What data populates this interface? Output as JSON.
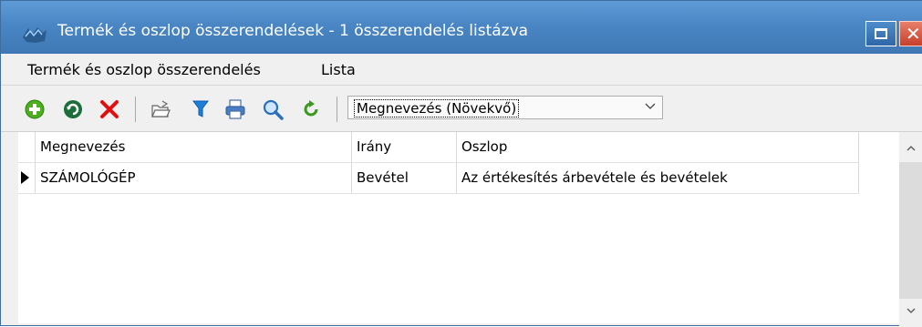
{
  "window": {
    "title": "Termék és oszlop összerendelések - 1 összerendelés listázva"
  },
  "menu": {
    "items": [
      {
        "label": "Termék és oszlop összerendelés"
      },
      {
        "label": "Lista"
      }
    ]
  },
  "toolbar": {
    "icons": [
      "add-icon",
      "refresh-icon",
      "delete-icon",
      "open-icon",
      "filter-icon",
      "print-icon",
      "search-icon",
      "reload-icon"
    ],
    "sort_value": "Megnevezés (Növekvő)"
  },
  "grid": {
    "columns": [
      "Megnevezés",
      "Irány",
      "Oszlop"
    ],
    "rows": [
      {
        "cells": [
          "SZÁMOLÓGÉP",
          "Bevétel",
          "Az értékesítés árbevétele és bevételek"
        ]
      }
    ]
  }
}
